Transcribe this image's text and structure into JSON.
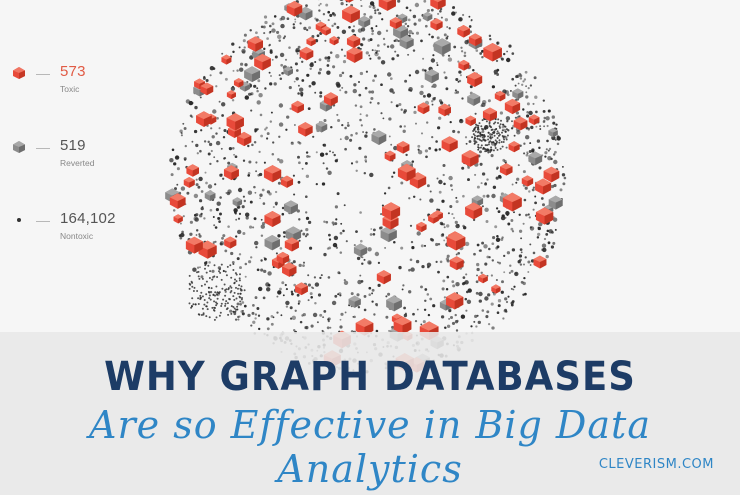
{
  "legend": [
    {
      "value": "573",
      "label": "Toxic",
      "marker": "red-gem-icon",
      "color": "#e84a3a"
    },
    {
      "value": "519",
      "label": "Reverted",
      "marker": "gray-gem-icon",
      "color": "#8c8c8c"
    },
    {
      "value": "164,102",
      "label": "Nontoxic",
      "marker": "dot-icon",
      "color": "#333333"
    }
  ],
  "title": {
    "main": "WHY GRAPH DATABASES",
    "sub": "Are so Effective in Big Data Analytics"
  },
  "brand": "CLEVERISM.COM",
  "colors": {
    "toxic": "#e84a3a",
    "reverted": "#8c8c8c",
    "nontoxic": "#2a2a2a",
    "title_main": "#1d3c66",
    "title_sub": "#2f86c6",
    "banner": "#e8e8e8"
  }
}
